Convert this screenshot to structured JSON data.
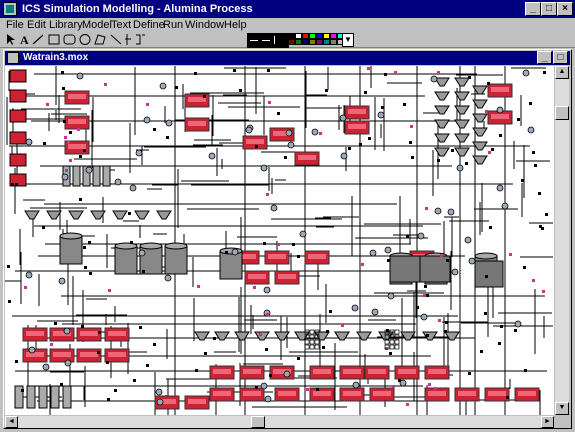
{
  "app": {
    "title": "ICS Simulation Modelling - Alumina Process",
    "minimize": "_",
    "maximize": "□",
    "close": "×"
  },
  "menu": [
    "File",
    "Edit",
    "Library",
    "Model",
    "Text",
    "Define",
    "Run",
    "Window",
    "Help"
  ],
  "toolbar": {
    "tools": [
      "pointer-tool",
      "text-tool",
      "line-tool",
      "rectangle-tool",
      "rounded-rectangle-tool",
      "ellipse-tool",
      "polygon-tool",
      "diagonal-line-tool",
      "vertical-line-tool",
      "bracket-tool"
    ],
    "palette_colors": [
      "#000000",
      "#ffffff",
      "#ff0000",
      "#00ff00",
      "#0000ff",
      "#ffff00",
      "#ff00ff",
      "#00ffff",
      "#800000",
      "#008000",
      "#000080",
      "#808000",
      "#800080",
      "#008080",
      "#808080",
      "#c0c0c0"
    ]
  },
  "document": {
    "title": "Watrain3.mox",
    "minimize": "_",
    "maximize": "□"
  },
  "scrollbar": {
    "up": "▲",
    "down": "▼",
    "left": "◄",
    "right": "►"
  },
  "colors": {
    "titlebar": "#000080",
    "chrome": "#c0c0c0",
    "canvas": "#ffffff",
    "tank_red": "#cc2233",
    "line": "#000000"
  }
}
